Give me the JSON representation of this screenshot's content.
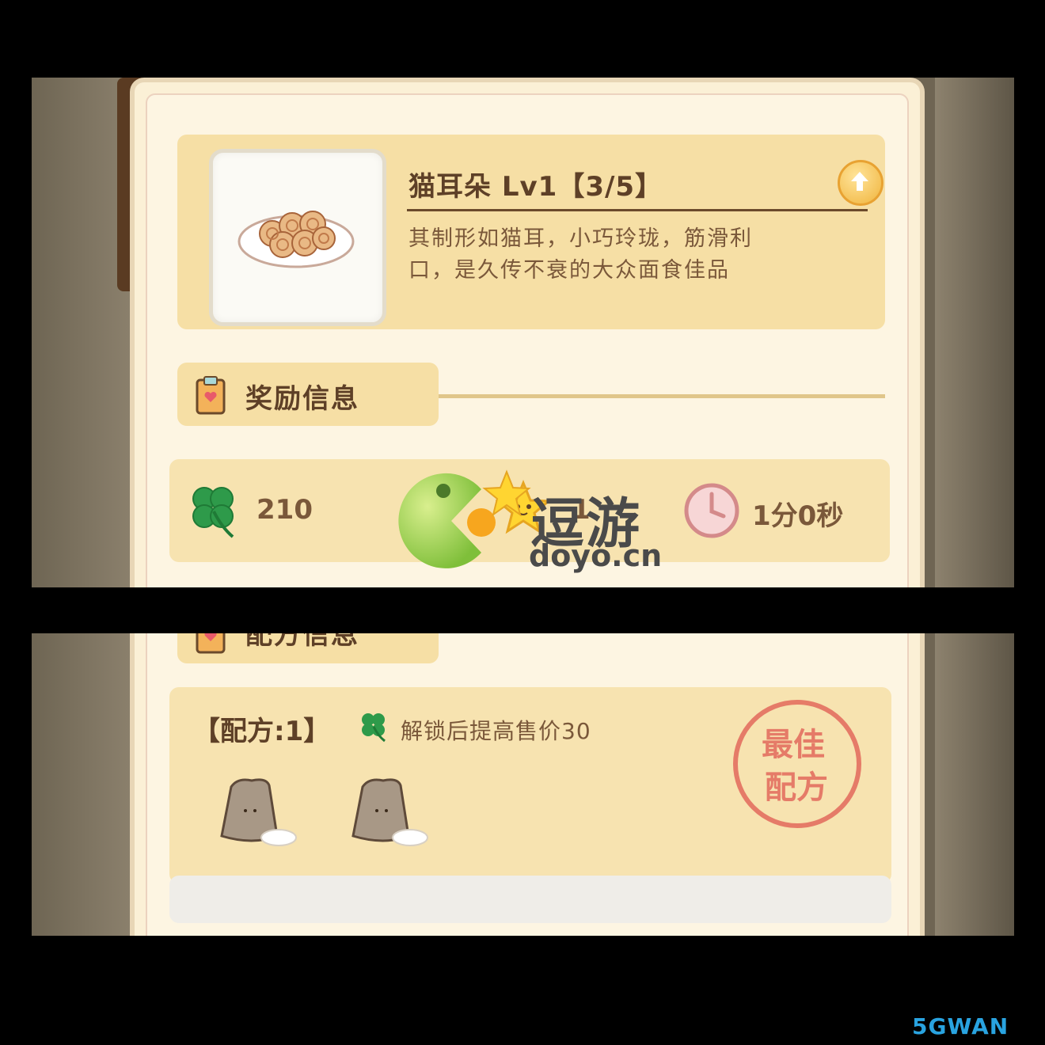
{
  "item": {
    "name": "猫耳朵 Lv1【3/5】",
    "description_line1": "其制形如猫耳，小巧玲珑，筋滑利",
    "description_line2": "口，是久传不衰的大众面食佳品"
  },
  "reward_section": {
    "title": "奖励信息",
    "clover_value": "210",
    "star_value": "1",
    "time_value": "1分0秒"
  },
  "recipe_section": {
    "title": "配方信息",
    "recipe_label": "【配方:1】",
    "hint": "解锁后提高售价30",
    "stamp_line1": "最佳",
    "stamp_line2": "配方"
  },
  "watermark": {
    "cn": "逗游",
    "en": "doyo.cn",
    "corner_logo": "5GWAN"
  },
  "icons": [
    "upgrade-arrow-icon",
    "clipboard-icon",
    "clover-icon",
    "star-icon",
    "clock-icon",
    "flour-bag-icon"
  ],
  "colors": {
    "panel_bg": "#fdf5e2",
    "box_bg": "#f6dfa5",
    "stamp": "#e36a5c",
    "clover": "#2e9a4a"
  }
}
